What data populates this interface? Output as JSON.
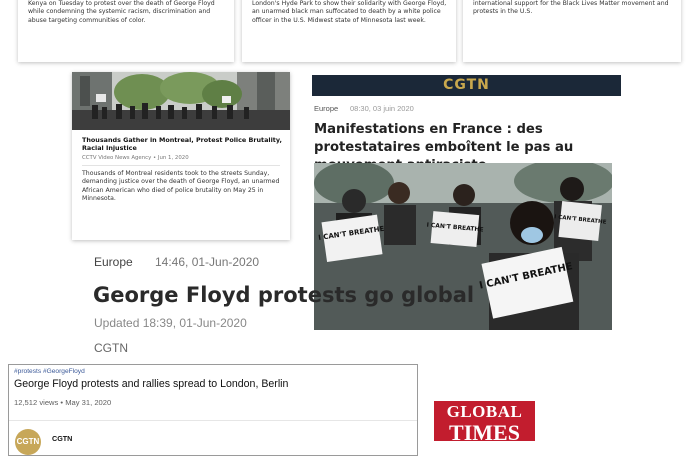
{
  "cards_top": [
    {
      "text": "Kenya on Tuesday to protest over the death of George Floyd while condemning the systemic racism, discrimination and abuse targeting communities of color."
    },
    {
      "text": "London's Hyde Park to show their solidarity with George Floyd, an unarmed black man suffocated to death by a white police officer in the U.S. Midwest state of Minnesota last week."
    },
    {
      "text": "international support for the Black Lives Matter movement and protests in the U.S."
    }
  ],
  "montreal": {
    "title": "Thousands Gather in Montreal, Protest Police Brutality, Racial Injustice",
    "meta": "CCTV Video News Agency • Jun 1, 2020",
    "body": "Thousands of Montreal residents took to the streets Sunday, demanding justice over the death of George Floyd, an unarmed African American who died of police brutality on May 25 in Minnesota."
  },
  "cgtn_fr": {
    "logo": "CGTN",
    "category": "Europe",
    "time": "08:30, 03 juin 2020",
    "title": "Manifestations en France : des protestataires emboîtent le  pas au mouvement antiraciste",
    "photo_signs": [
      "I CAN'T BREATHE",
      "I CAN'T BREATHE",
      "I CAN'T BREATHE",
      "I CAN'T BREATHE"
    ]
  },
  "cgtn_global": {
    "category": "Europe",
    "time": "14:46, 01-Jun-2020",
    "title": "George Floyd protests go global",
    "updated": "Updated 18:39, 01-Jun-2020",
    "source": "CGTN"
  },
  "video": {
    "tags": "#protests #GeorgeFloyd",
    "title": "George Floyd protests and rallies spread to London, Berlin",
    "meta": "12,512 views • May 31, 2020",
    "channel": "CGTN",
    "avatar_text": "CGTN"
  },
  "global_times": {
    "line1": "GLOBAL",
    "line2": "TIMES"
  },
  "colors": {
    "cgtn_bar": "#1b2838",
    "cgtn_gold": "#c9a84d",
    "global_times_red": "#c21d2e"
  }
}
